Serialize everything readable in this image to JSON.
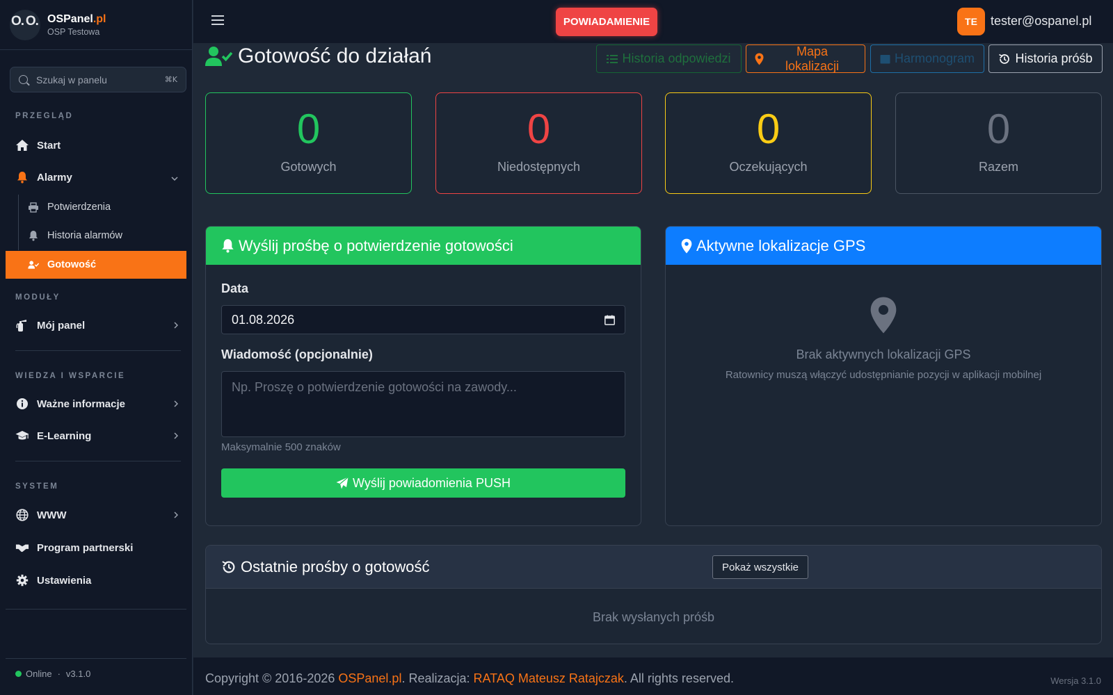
{
  "brand": {
    "name_main": "OSPanel",
    "name_accent": ".pl",
    "subtitle": "OSP Testowa",
    "logo_text": "Ο. O."
  },
  "search": {
    "placeholder": "Szukaj w panelu",
    "shortcut": "⌘K"
  },
  "sidebar": {
    "sections": {
      "overview": "PRZEGLĄD",
      "modules": "MODUŁY",
      "knowledge": "WIEDZA I WSPARCIE",
      "system": "SYSTEM"
    },
    "items": {
      "start": "Start",
      "alarms": "Alarmy",
      "confirmations": "Potwierdzenia",
      "alarm_history": "Historia alarmów",
      "readiness": "Gotowość",
      "my_panel": "Mój panel",
      "important_info": "Ważne informacje",
      "elearning": "E-Learning",
      "www": "WWW",
      "partner_program": "Program partnerski",
      "settings": "Ustawienia"
    },
    "status": "Online",
    "version": "v3.1.0",
    "active_item": "readiness",
    "accent_color": "#f97316"
  },
  "topbar": {
    "notify_button": "POWIADAMIENIE",
    "avatar_initials": "TE",
    "user_email": "tester@ospanel.pl"
  },
  "page": {
    "title": "Gotowość do działań",
    "buttons": {
      "answers_history": "Historia odpowiedzi",
      "location_map": "Mapa lokalizacji",
      "third": "Harmonogram",
      "requests_history": "Historia próśb"
    }
  },
  "stats": [
    {
      "value": "0",
      "label": "Gotowych",
      "color": "#22c55e"
    },
    {
      "value": "0",
      "label": "Niedostępnych",
      "color": "#ef4444"
    },
    {
      "value": "0",
      "label": "Oczekujących",
      "color": "#facc15"
    },
    {
      "value": "0",
      "label": "Razem",
      "color": "#6b7280"
    }
  ],
  "form": {
    "title": "Wyślij prośbę o potwierdzenie gotowości",
    "date_label": "Data",
    "date_value": "01.08.2026",
    "message_label": "Wiadomość (opcjonalnie)",
    "message_placeholder": "Np. Proszę o potwierdzenie gotowości na zawody...",
    "hint": "Maksymalnie 500 znaków",
    "submit": "Wyślij powiadomienia PUSH"
  },
  "gps": {
    "title": "Aktywne lokalizacje GPS",
    "empty_main": "Brak aktywnych lokalizacji GPS",
    "empty_sub": "Ratownicy muszą włączyć udostępnianie pozycji w aplikacji mobilnej"
  },
  "recent": {
    "title": "Ostatnie prośby o gotowość",
    "show_all": "Pokaż wszystkie",
    "empty": "Brak wysłanych próśb"
  },
  "footer": {
    "prefix": "Copyright © 2016-2026 ",
    "brand_link": "OSPanel.pl",
    "middle": ". Realizacja: ",
    "author_link": "RATAQ Mateusz Ratajczak",
    "suffix": ". All rights reserved.",
    "version": "Wersja 3.1.0"
  }
}
